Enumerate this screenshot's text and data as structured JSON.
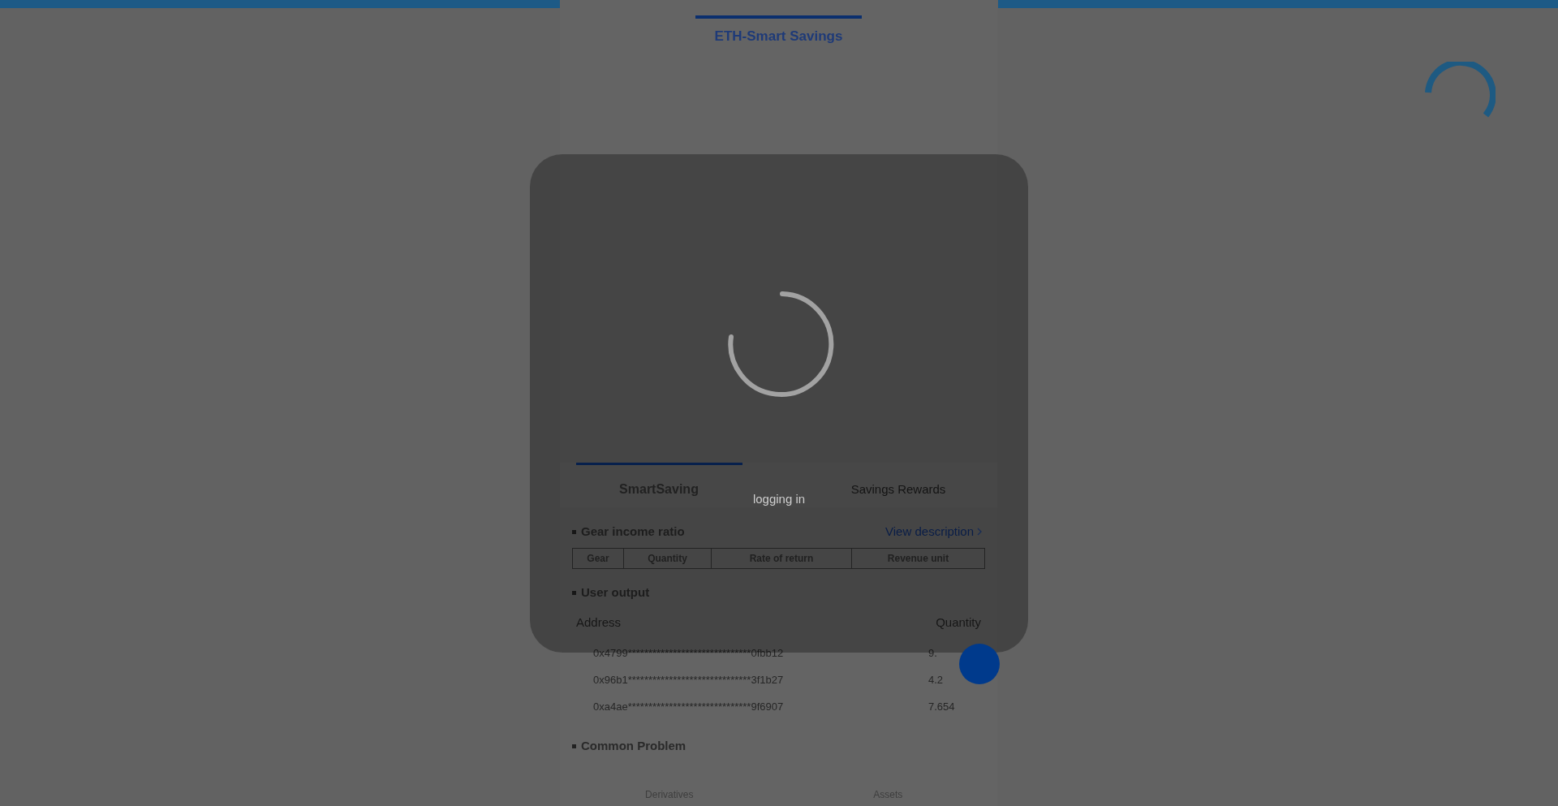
{
  "header": {
    "title": "ETH-Smart Savings",
    "selected": true
  },
  "tabs": [
    {
      "label": "SmartSaving",
      "selected": true
    },
    {
      "label": "Savings Rewards",
      "selected": false
    }
  ],
  "gear_income": {
    "title": "Gear income ratio",
    "link": "View description",
    "columns": [
      "Gear",
      "Quantity",
      "Rate of return",
      "Revenue unit"
    ]
  },
  "user_output": {
    "title": "User output",
    "columns": [
      "Address",
      "Quantity"
    ],
    "rows": [
      {
        "address": "0x4799******************************0fbb12",
        "quantity": "9."
      },
      {
        "address": "0x96b1******************************3f1b27",
        "quantity": "4.2"
      },
      {
        "address": "0xa4ae******************************9f6907",
        "quantity": "7.654"
      }
    ]
  },
  "common_problem": {
    "title": "Common Problem"
  },
  "bottom_nav": [
    {
      "label": "Derivatives"
    },
    {
      "label": "Assets"
    }
  ],
  "loading": {
    "message": "logging in"
  }
}
